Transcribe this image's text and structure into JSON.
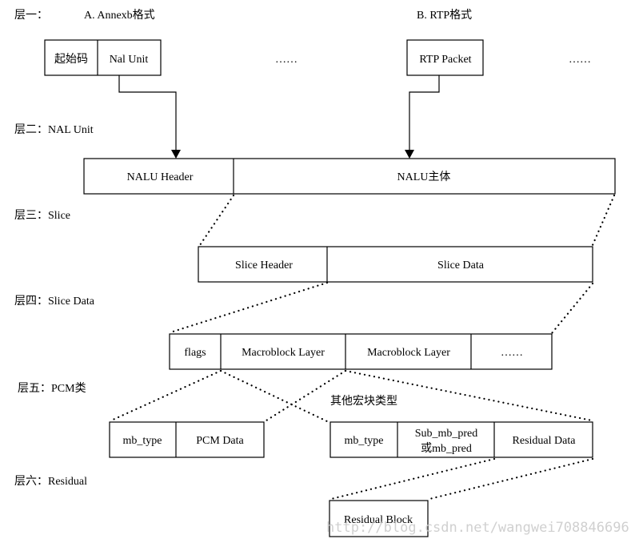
{
  "layers": [
    {
      "id": "layer1",
      "label": "层一："
    },
    {
      "id": "layer2",
      "label": "层二：NAL Unit"
    },
    {
      "id": "layer3",
      "label": "层三：Slice"
    },
    {
      "id": "layer4",
      "label": "层四：Slice Data"
    },
    {
      "id": "layer5",
      "label": "层五：PCM类"
    },
    {
      "id": "layer6",
      "label": "层六：Residual"
    }
  ],
  "layer1": {
    "annexb_title": "A. Annexb格式",
    "rtp_title": "B. RTP格式",
    "annexb_cells": [
      "起始码",
      "Nal Unit"
    ],
    "annexb_ellipsis": "……",
    "rtp_cell": "RTP Packet",
    "rtp_ellipsis": "……"
  },
  "nal_unit": {
    "cells": [
      "NALU Header",
      "NALU主体"
    ]
  },
  "slice": {
    "cells": [
      "Slice Header",
      "Slice Data"
    ]
  },
  "slice_data": {
    "cells": [
      "flags",
      "Macroblock Layer",
      "Macroblock Layer",
      "……"
    ]
  },
  "pcm": {
    "cells": [
      "mb_type",
      "PCM Data"
    ]
  },
  "other_mb": {
    "title": "其他宏块类型",
    "cells": [
      "mb_type",
      "Sub_mb_pred",
      "或mb_pred",
      "Residual Data"
    ]
  },
  "residual": {
    "cells": [
      "Residual Block"
    ]
  },
  "watermark": "http://blog.csdn.net/wangwei708846696"
}
